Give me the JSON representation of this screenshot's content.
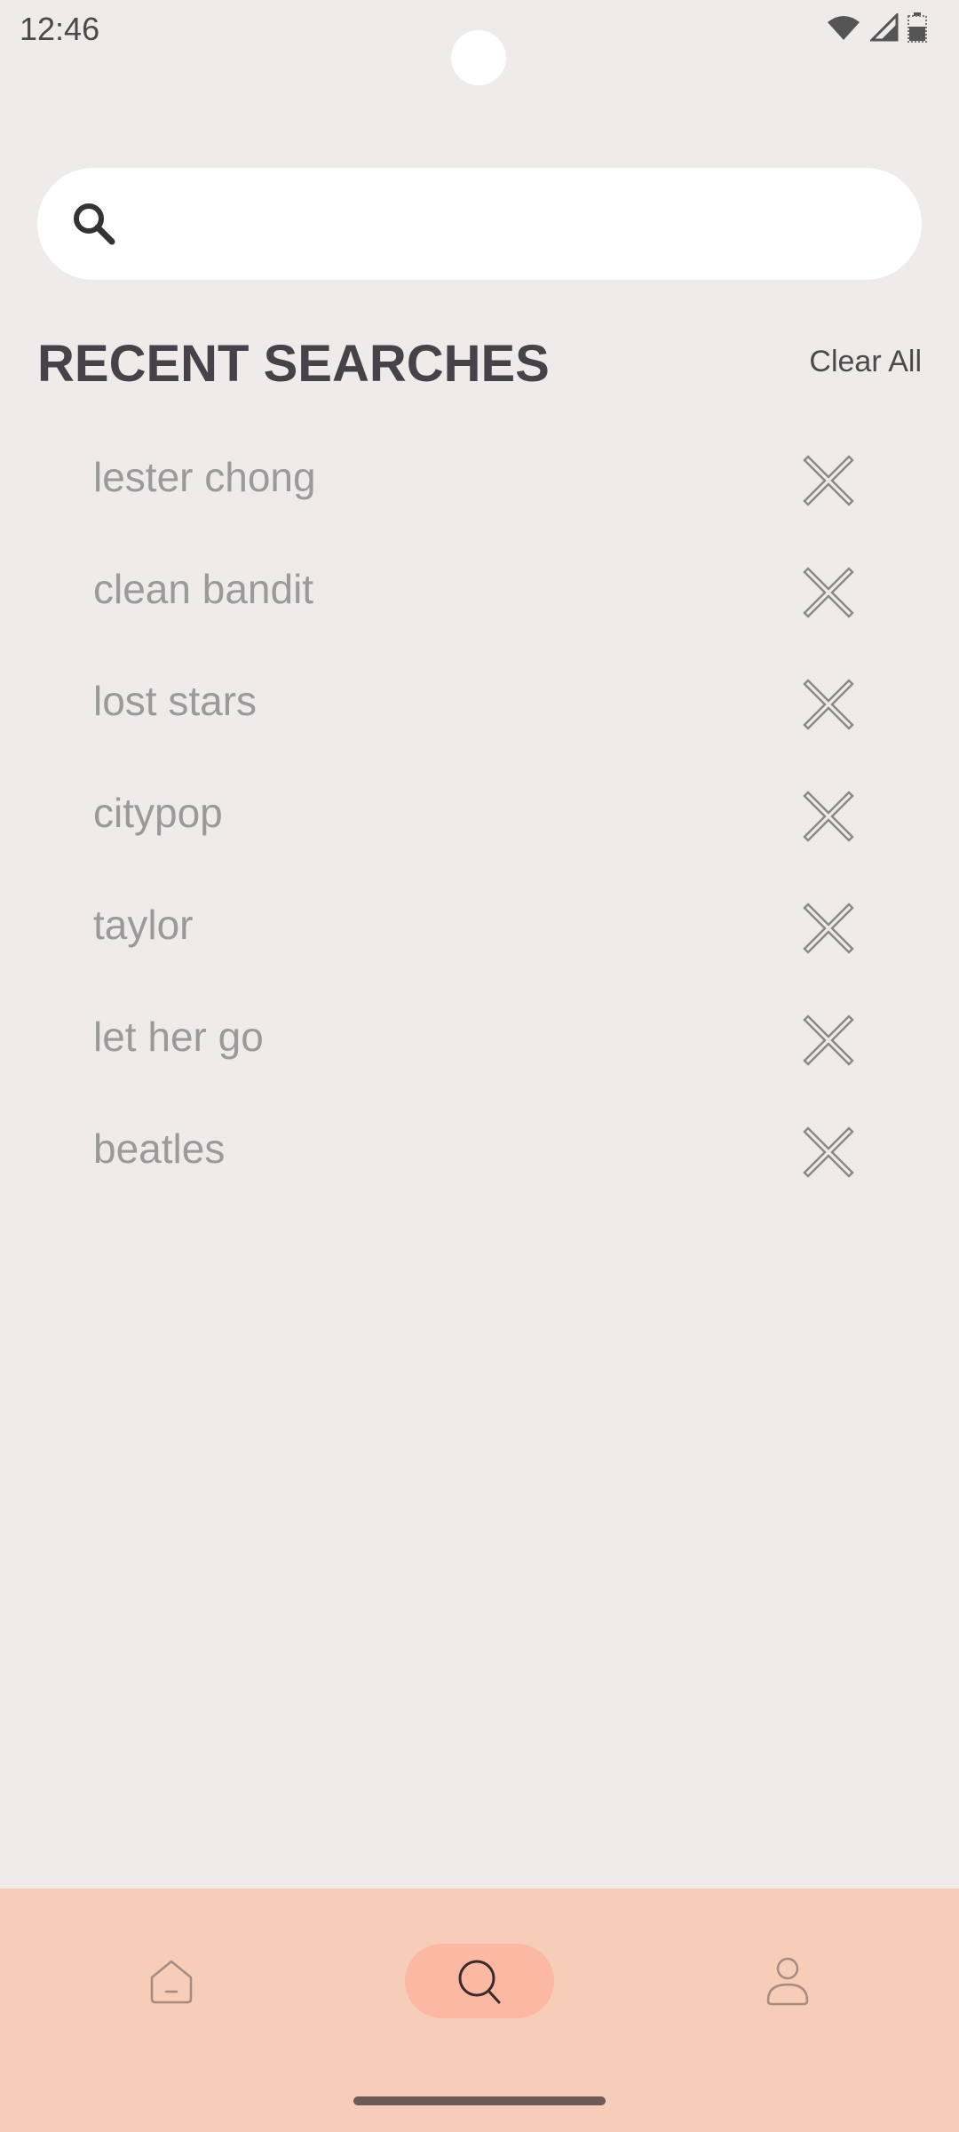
{
  "status_bar": {
    "time": "12:46",
    "icons": [
      "wifi-icon",
      "signal-icon",
      "battery-icon"
    ]
  },
  "search": {
    "placeholder": "",
    "value": "",
    "icon": "search-icon"
  },
  "recent": {
    "title": "RECENT SEARCHES",
    "clear_all_label": "Clear All",
    "items": [
      {
        "label": "lester chong"
      },
      {
        "label": "clean bandit"
      },
      {
        "label": "lost stars"
      },
      {
        "label": "citypop"
      },
      {
        "label": "taylor"
      },
      {
        "label": "let her go"
      },
      {
        "label": "beatles"
      }
    ]
  },
  "bottom_nav": {
    "items": [
      {
        "icon": "home-icon",
        "active": false
      },
      {
        "icon": "search-icon",
        "active": true
      },
      {
        "icon": "profile-icon",
        "active": false
      }
    ]
  },
  "colors": {
    "background": "#efebea",
    "nav_background": "#f6cdb9",
    "nav_active": "#fbb8a3",
    "title": "#45424a",
    "item_text": "#9a9a9a"
  }
}
